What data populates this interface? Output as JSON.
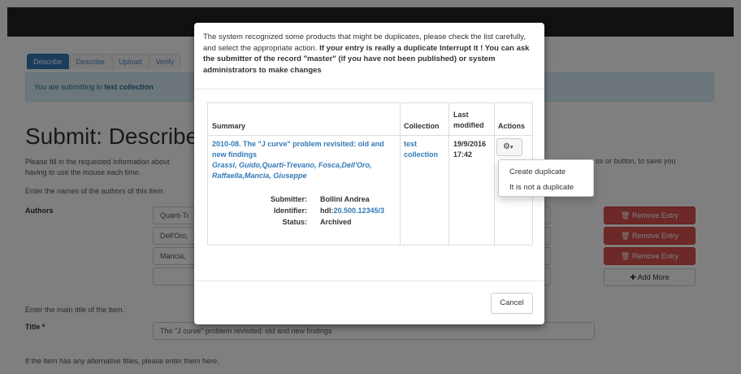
{
  "tabs": [
    "Describe",
    "Describe",
    "Upload",
    "Verify"
  ],
  "info": {
    "prefix": "You are submitting in ",
    "collection": "test collection"
  },
  "page_title": "Submit: Describe",
  "help_text": "Please fill in the requested information about",
  "help_text_2": "having to use the mouse each time.",
  "help_text_right": "ox or button, to save you",
  "authors_help": "Enter the names of the authors of this item",
  "authors_label": "Authors",
  "authors": [
    "Quarti-Tr",
    "Dell'Oro,",
    "Mancia,",
    ""
  ],
  "remove_label": "Remove Entry",
  "add_more_label": "Add More",
  "title_help": "Enter the main title of the item.",
  "title_label": "Title *",
  "title_value": "The \"J curve\" problem revisited: old and new findings",
  "alt_titles_help": "If the item has any alternative titles, please enter them here.",
  "modal": {
    "intro": "The system recognized some products that might be duplicates, please check the list carefully, and select the appropriate action.",
    "bold_1": "If your entry is really a duplicate Interrupt it ! You can ask the submitter of the record \"master\" (if you have not been published) or system administrators to make changes",
    "headers": {
      "summary": "Summary",
      "collection": "Collection",
      "last": "Last",
      "modified": "modified",
      "actions": "Actions"
    },
    "row": {
      "title": "2010-08. The \"J curve\" problem revisited: old and new findings",
      "authors": "Grassi, Guido,Quarti-Trevano, Fosca,Dell'Oro, Raffaella,Mancia, Giuseppe",
      "submitter_label": "Submitter:",
      "submitter": "Bollini Andrea",
      "identifier_label": "Identifier:",
      "identifier_prefix": "hdl:",
      "identifier_link": "20.500.12345/3",
      "status_label": "Status:",
      "status": "Archived",
      "collection_1": "test",
      "collection_2": "collection",
      "date": "19/9/2016",
      "time": "17:42"
    },
    "menu": [
      "Create duplicate",
      "It is not a duplicate"
    ],
    "cancel": "Cancel"
  }
}
